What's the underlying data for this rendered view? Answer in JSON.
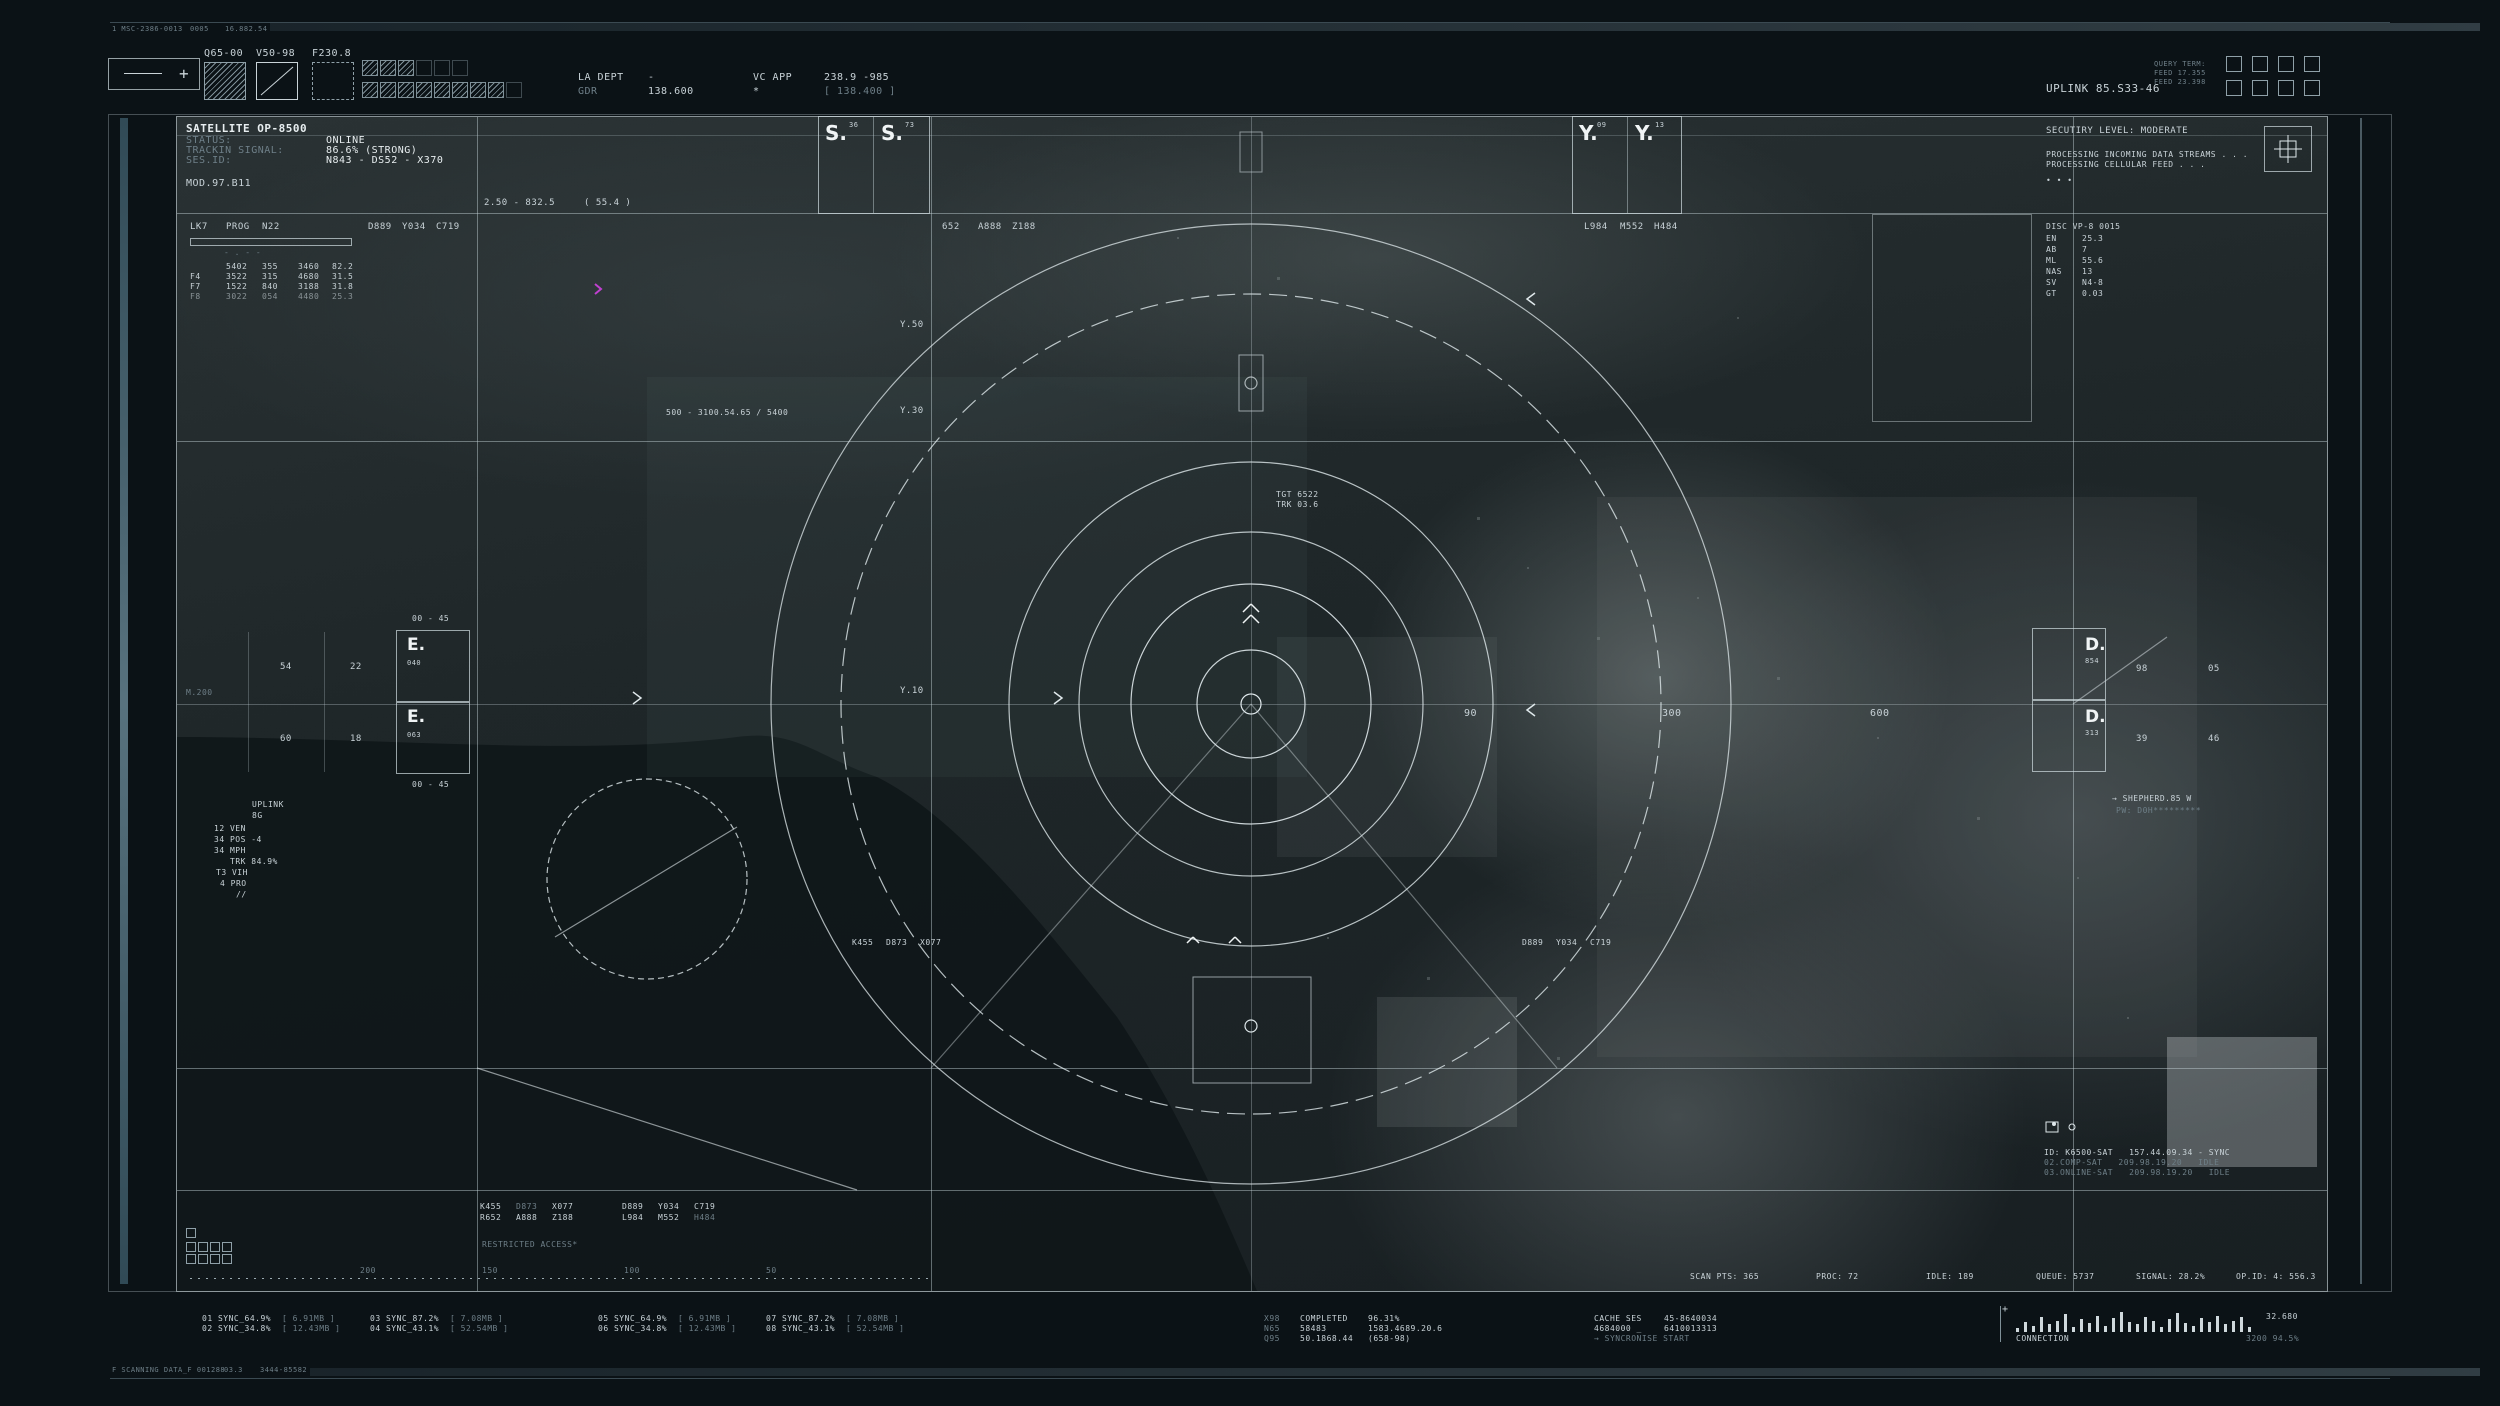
{
  "topbar": {
    "left_tiny": "1 MSC-2386-0013",
    "mid_tiny1": "0005",
    "mid_tiny2": "16.882.54"
  },
  "toolbar": {
    "q": "Q65-00",
    "v": "V50-98",
    "f": "F230.8",
    "la_dept_label": "LA DEPT",
    "la_dept_value": "-",
    "gdr_label": "GDR",
    "gdr_value": "138.600",
    "vc_app_label": "VC APP",
    "vc_app_value": "238.9 -985",
    "vc_app_sub": "[ 138.400 ]",
    "star": "*",
    "uplink": "UPLINK 85.S33-46",
    "query_lines": [
      "QUERY TERM:",
      "FEED 17.355",
      "FEED 23.398"
    ]
  },
  "satellite": {
    "title": "SATELLITE OP-8500",
    "rows": [
      {
        "label": "STATUS:",
        "value": "ONLINE"
      },
      {
        "label": "TRACKIN SIGNAL:",
        "value": "86.6% (STRONG)"
      },
      {
        "label": "SES.ID:",
        "value": "N843 - DS52 - X370"
      }
    ],
    "mod": "MOD.97.B11",
    "range": "2.50 - 832.5",
    "range2": "( 55.4 )"
  },
  "lk_table": {
    "headers": [
      "LK7",
      "PROG",
      "N22"
    ],
    "dashes": "- . - -",
    "rows": [
      [
        "",
        "5402",
        "355",
        "3460",
        "82.2"
      ],
      [
        "F4",
        "3522",
        "315",
        "4680",
        "31.5"
      ],
      [
        "F7",
        "1522",
        "840",
        "3188",
        "31.8"
      ],
      [
        "F8",
        "3022",
        "054",
        "4480",
        "25.3"
      ]
    ],
    "codes": [
      "D889",
      "Y034",
      "C719"
    ]
  },
  "top_labels": {
    "s1": "S.",
    "s1_sup": "36",
    "s2": "S.",
    "s2_sup": "73",
    "y1": "Y.",
    "y1_sup": "09",
    "y2": "Y.",
    "y2_sup": "13",
    "codes_mid": [
      "652",
      "A888",
      "Z188"
    ],
    "codes_right": [
      "L984",
      "M552",
      "H484"
    ]
  },
  "security": {
    "level": "SECUTIRY LEVEL: MODERATE",
    "line1": "PROCESSING INCOMING DATA STREAMS . . .",
    "line2": "PROCESSING CELLULAR FEED . . ."
  },
  "disc": {
    "title": "DISC VP-8 0015",
    "rows": [
      [
        "EN",
        "25.3"
      ],
      [
        "AB",
        "7"
      ],
      [
        "ML",
        "55.6"
      ],
      [
        "NAS",
        "13"
      ],
      [
        "SV",
        "N4-8"
      ],
      [
        "GT",
        "0.03"
      ]
    ]
  },
  "map_labels": {
    "y50": "Y.50",
    "y30": "Y.30",
    "y10": "Y.10",
    "coords": "500 - 3100.54.65 / 5400",
    "tgt": "TGT 6522",
    "trk": "TRK 03.6",
    "n90": "90",
    "n300": "300",
    "n600": "600",
    "codes_low_left": [
      "K455",
      "D873",
      "X077"
    ],
    "codes_low_right": [
      "D889",
      "Y034",
      "C719"
    ],
    "shepherd": "→ SHEPHERD.85 W",
    "pw": "PW: D0H*********"
  },
  "left_panel": {
    "e1": "E.",
    "e1_sub": "040",
    "e2": "E.",
    "e2_sub": "063",
    "top_range": "00 - 45",
    "bottom_range": "00 - 45",
    "n54": "54",
    "n22": "22",
    "n60": "60",
    "n18": "18",
    "m200": "M.200",
    "uplink_title": "UPLINK",
    "uplink_lines": [
      "8G",
      "12 VEN",
      "34 POS -4",
      "34 MPH",
      "TRK 84.9%",
      "T3 VIH",
      "4 PRO",
      "//"
    ]
  },
  "right_panel": {
    "d1": "D.",
    "d1_sub": "854",
    "d2": "D.",
    "d2_sub": "313",
    "n98": "98",
    "n05": "05",
    "n39": "39",
    "n46": "46"
  },
  "sync_panel": {
    "line1": "ID: K6500-SAT   157.44.09.34 - SYNC",
    "line2": "02.COMP-SAT   209.98.19.20   IDLE",
    "line3": "03.ONLINE-SAT   209.98.19.20   IDLE"
  },
  "map_bottom": {
    "left_codes_row1": [
      "K455",
      "D873",
      "X077",
      "D889",
      "Y034",
      "C719"
    ],
    "left_codes_row2": [
      "R652",
      "A888",
      "Z188",
      "L984",
      "M552",
      "H484"
    ],
    "restricted": "RESTRICTED ACCESS*",
    "scale": [
      "200",
      "150",
      "100",
      "50"
    ],
    "status": [
      {
        "label": "SCAN PTS:",
        "value": "365"
      },
      {
        "label": "PROC:",
        "value": "72"
      },
      {
        "label": "IDLE:",
        "value": "189"
      },
      {
        "label": "QUEUE:",
        "value": "5737"
      },
      {
        "label": "SIGNAL:",
        "value": "28.2%"
      },
      {
        "label": "OP.ID:",
        "value": "4: 556.3"
      }
    ]
  },
  "footer": {
    "sync_a": [
      "01 SYNC_64.9%",
      "02 SYNC_34.8%"
    ],
    "sync_a_mb": [
      "[ 6.91MB ]",
      "[ 12.43MB ]"
    ],
    "sync_b": [
      "03 SYNC_87.2%",
      "04 SYNC_43.1%"
    ],
    "sync_b_mb": [
      "[ 7.08MB ]",
      "[ 52.54MB ]"
    ],
    "sync_c": [
      "05 SYNC_64.9%",
      "06 SYNC_34.8%"
    ],
    "sync_c_mb": [
      "[ 6.91MB ]",
      "[ 12.43MB ]"
    ],
    "sync_d": [
      "07 SYNC_87.2%",
      "08 SYNC_43.1%"
    ],
    "sync_d_mb": [
      "[ 7.08MB ]",
      "[ 52.54MB ]"
    ],
    "completed_codes": [
      "X98",
      "N65",
      "Q95"
    ],
    "completed": [
      "COMPLETED",
      "58483",
      "50.1868.44"
    ],
    "completed_vals": [
      "96.31%",
      "1583.4689.20.6",
      "(658-98)"
    ],
    "cache": [
      "CACHE SES",
      "4684000 _",
      "→ SYNCRONISE START"
    ],
    "cache_vals": [
      "45-8640034",
      "6410013313"
    ],
    "connection": "CONNECTION",
    "conn_value": "32.680",
    "conn_pct": "3200 94.5%",
    "bottom_tiny1": "F SCANNING DATA_F 001288",
    "bottom_tiny2": "03.3",
    "bottom_tiny3": "3444-85582"
  },
  "colors": {
    "accent_magenta": "#c040d0",
    "ui_line": "#d2dee2",
    "bg": "#0b1216"
  },
  "signal_bars": [
    3,
    8,
    5,
    12,
    6,
    9,
    14,
    4,
    10,
    7,
    13,
    5,
    11,
    16,
    8,
    6,
    12,
    9,
    4,
    10,
    15,
    7,
    5,
    11,
    8,
    13,
    6,
    9,
    12,
    4
  ]
}
